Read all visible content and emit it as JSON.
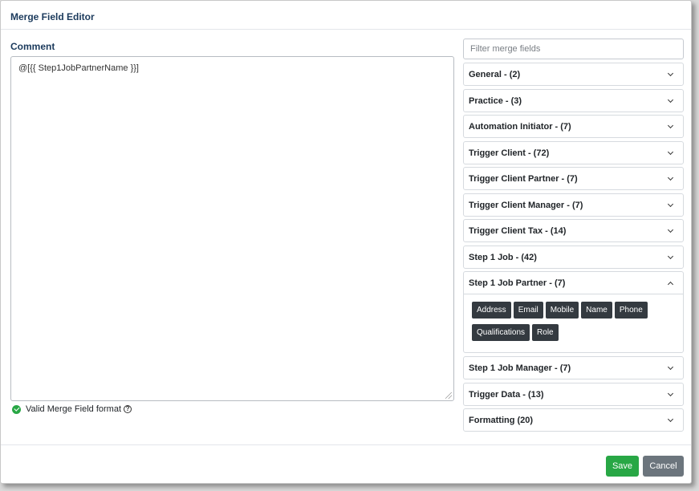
{
  "modal": {
    "title": "Merge Field Editor"
  },
  "comment": {
    "label": "Comment",
    "value": "@[{{ Step1JobPartnerName }}]"
  },
  "validation": {
    "text": "Valid Merge Field format",
    "help_glyph": "?"
  },
  "filter": {
    "placeholder": "Filter merge fields",
    "value": ""
  },
  "groups": [
    {
      "label": "General - (2)",
      "expanded": false
    },
    {
      "label": "Practice - (3)",
      "expanded": false
    },
    {
      "label": "Automation Initiator - (7)",
      "expanded": false
    },
    {
      "label": "Trigger Client - (72)",
      "expanded": false
    },
    {
      "label": "Trigger Client Partner - (7)",
      "expanded": false
    },
    {
      "label": "Trigger Client Manager - (7)",
      "expanded": false
    },
    {
      "label": "Trigger Client Tax - (14)",
      "expanded": false
    },
    {
      "label": "Step 1 Job - (42)",
      "expanded": false
    },
    {
      "label": "Step 1 Job Partner - (7)",
      "expanded": true
    },
    {
      "label": "Step 1 Job Manager - (7)",
      "expanded": false
    },
    {
      "label": "Trigger Data - (13)",
      "expanded": false
    },
    {
      "label": "Formatting (20)",
      "expanded": false
    }
  ],
  "partner_fields": [
    "Address",
    "Email",
    "Mobile",
    "Name",
    "Phone",
    "Qualifications",
    "Role"
  ],
  "footer": {
    "save_label": "Save",
    "cancel_label": "Cancel"
  },
  "colors": {
    "save": "#28a745",
    "cancel": "#6c757d",
    "chip": "#343a40",
    "title": "#1b3a5c"
  },
  "icons": {
    "valid": "check-circle-icon",
    "help": "question-circle-icon",
    "collapsed": "chevron-down-icon",
    "expanded": "chevron-up-icon"
  }
}
